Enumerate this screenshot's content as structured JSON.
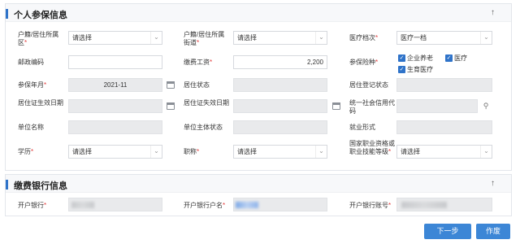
{
  "personal": {
    "title": "个人参保信息",
    "collapse_icon": "↑",
    "hukou_area_label": "户籍/居住所属区",
    "hukou_area_value": "请选择",
    "hukou_street_label": "户籍/居住所属街道",
    "hukou_street_value": "请选择",
    "medical_level_label": "医疗档次",
    "medical_level_value": "医疗一档",
    "postcode_label": "邮政编码",
    "postcode_value": "",
    "salary_label": "缴费工资",
    "salary_value": "2,200",
    "insurance_label": "参保险种",
    "insurance_options": [
      "企业养老",
      "医疗",
      "生育医疗"
    ],
    "insured_month_label": "参保年月",
    "insured_month_value": "2021-11",
    "residence_status_label": "居住状态",
    "residence_reg_label": "居住登记状态",
    "residence_valid_label": "居住证生效日期",
    "residence_invalid_label": "居住证失效日期",
    "credit_code_label": "统一社会信用代码",
    "company_name_label": "单位名称",
    "company_status_label": "单位主体状态",
    "employment_form_label": "就业形式",
    "education_label": "学历",
    "education_value": "请选择",
    "title_label": "职称",
    "title_value": "请选择",
    "qualification_label": "国家职业资格或职业技能等级",
    "qualification_value": "请选择"
  },
  "bank": {
    "title": "缴费银行信息",
    "collapse_icon": "↑",
    "bank_label": "开户银行",
    "holder_label": "开户银行户名",
    "account_label": "开户银行账号"
  },
  "actions": {
    "next_label": "下一步",
    "void_label": "作废"
  },
  "colors": {
    "accent": "#2f73c9",
    "button": "#3c86d6",
    "required": "#e23c3c"
  },
  "icons": {
    "dropdown": "chevron-down-icon",
    "calendar": "calendar-icon",
    "search": "search-icon",
    "check": "checkbox-checked-icon"
  }
}
